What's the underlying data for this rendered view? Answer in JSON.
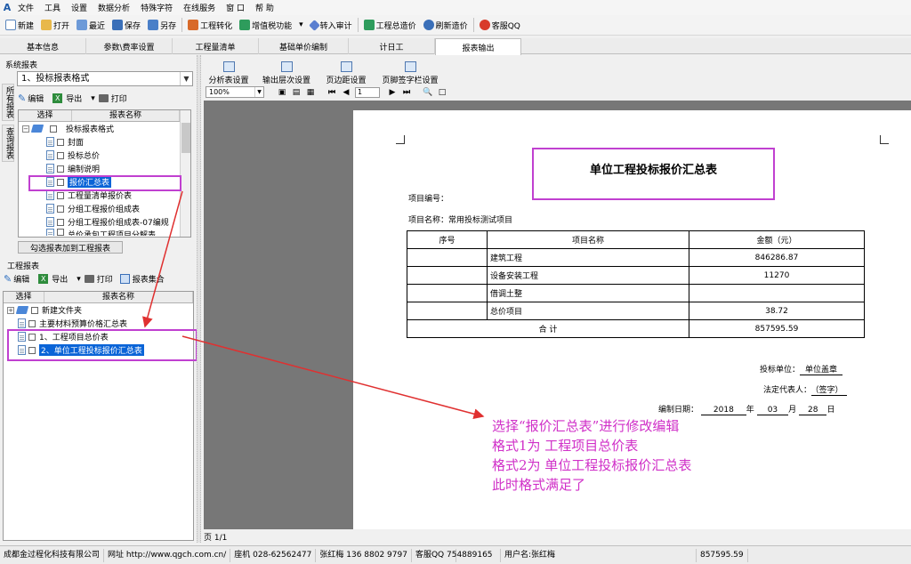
{
  "menu": {
    "items": [
      "文件",
      "工具",
      "设置",
      "数据分析",
      "特殊字符",
      "在线服务",
      "窗 口",
      "帮 助"
    ]
  },
  "toolbar": {
    "items": [
      "新建",
      "打开",
      "最近",
      "保存",
      "另存",
      "工程转化",
      "增值税功能",
      "转入审计",
      "工程总造价",
      "刷新造价",
      "客服QQ"
    ]
  },
  "tabs": [
    "基本信息",
    "参数\\费率设置",
    "工程量清单",
    "基础单价编制",
    "计日工",
    "报表输出"
  ],
  "active_tab": "报表输出",
  "left": {
    "system_reports_title": "系统报表",
    "format_select": "1、投标报表格式",
    "vtabs": [
      "所有报表",
      "查询报表"
    ],
    "sub_toolbar": {
      "edit": "编辑",
      "export": "导出",
      "print": "打印"
    },
    "grid_headers": {
      "select": "选择",
      "name": "报表名称"
    },
    "tree_root": "投标报表格式",
    "tree_items": [
      "封面",
      "投标总价",
      "编制说明",
      "报价汇总表",
      "工程量清单报价表",
      "分组工程报价组成表",
      "分组工程报价组成表-07编规",
      "总价承包工程项目分解表"
    ],
    "add_button": "勾选报表加到工程报表",
    "project_reports_title": "工程报表",
    "proj_toolbar": {
      "edit": "编辑",
      "export": "导出",
      "print": "打印",
      "collection": "报表集合"
    },
    "proj_items": [
      "新建文件夹",
      "主要材料预算价格汇总表",
      "1、工程项目总价表",
      "2、单位工程投标报价汇总表"
    ]
  },
  "right": {
    "tools": [
      "分析表设置",
      "输出层次设置",
      "页边距设置",
      "页脚签字栏设置"
    ],
    "zoom": "100%",
    "page_num": "1",
    "page_indicator": "页 1/1"
  },
  "report": {
    "title": "单位工程投标报价汇总表",
    "project_no_label": "项目编号：",
    "project_name_label": "项目名称：常用投标测试项目",
    "headers": [
      "序号",
      "项目名称",
      "金额（元）"
    ],
    "rows": [
      {
        "no": "",
        "name": "建筑工程",
        "amount": "846286.87"
      },
      {
        "no": "",
        "name": "设备安装工程",
        "amount": "11270"
      },
      {
        "no": "",
        "name": "借调土整",
        "amount": ""
      },
      {
        "no": "",
        "name": "总价项目",
        "amount": "38.72"
      }
    ],
    "total_label": "合      计",
    "total_amount": "857595.59",
    "bidder_label": "投标单位：",
    "bidder_value": "单位盖章",
    "rep_label": "法定代表人：",
    "rep_value": "（签字）",
    "date_label": "编制日期：",
    "date_year": "2018",
    "date_y": "年",
    "date_month": "03",
    "date_m": "月",
    "date_day": "28",
    "date_d": "日"
  },
  "annotation": {
    "lines": [
      "选择“报价汇总表”进行修改编辑",
      "格式1为  工程项目总价表",
      "格式2为  单位工程投标报价汇总表",
      "此时格式满足了"
    ]
  },
  "status": {
    "company": "成都金过程化科技有限公司",
    "website": "网址 http://www.qgch.com.cn/",
    "phone": "座机 028-62562477",
    "contact": "张红梅 136 8802 9797",
    "qq": "客服QQ 754889165",
    "user": "用户名:张红梅",
    "total": "857595.59"
  },
  "colors": {
    "highlight": "#c040d0",
    "selection": "#0a64d7",
    "annotation": "#d030c8"
  }
}
